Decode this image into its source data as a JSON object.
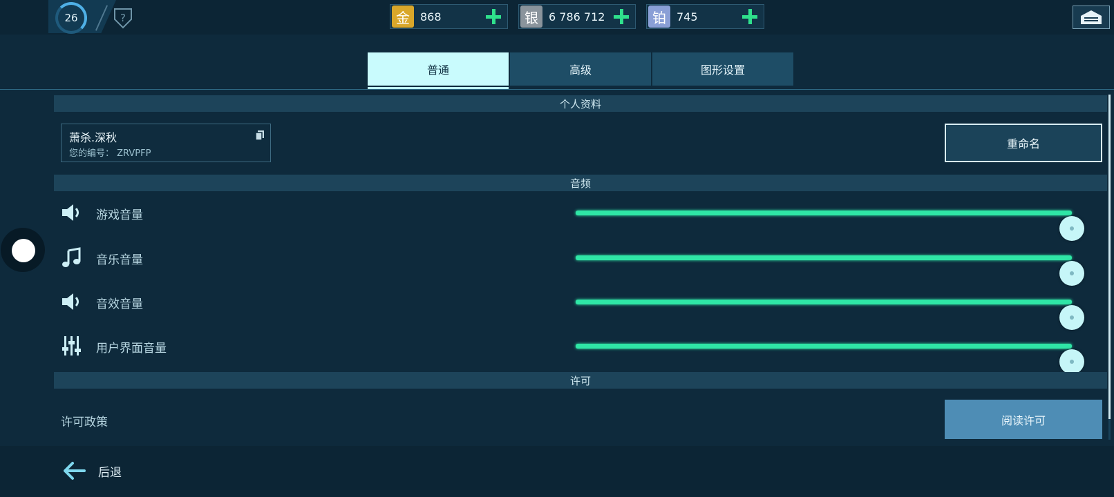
{
  "header": {
    "level": "26",
    "currencies": [
      {
        "name": "gold",
        "symbol": "金",
        "value": "868",
        "color": "#d9a72a"
      },
      {
        "name": "silver",
        "symbol": "银",
        "value": "6 786 712",
        "color": "#8a949c"
      },
      {
        "name": "platinum",
        "symbol": "铂",
        "value": "745",
        "color": "#8a9fd6"
      }
    ]
  },
  "tabs": [
    {
      "label": "普通",
      "active": true
    },
    {
      "label": "高级",
      "active": false
    },
    {
      "label": "图形设置",
      "active": false
    }
  ],
  "profile": {
    "section_title": "个人资料",
    "name": "萧杀.深秋",
    "id_text": "您的编号： ZRVPFP",
    "rename_label": "重命名"
  },
  "audio": {
    "section_title": "音频",
    "rows": [
      {
        "label": "游戏音量",
        "icon": "speaker-icon",
        "level": 1.0
      },
      {
        "label": "音乐音量",
        "icon": "music-note-icon",
        "level": 1.0
      },
      {
        "label": "音效音量",
        "icon": "speaker-icon",
        "level": 1.0
      },
      {
        "label": "用户界面音量",
        "icon": "equalizer-icon",
        "level": 1.0
      }
    ]
  },
  "license": {
    "section_title": "许可",
    "policy_label": "许可政策",
    "read_label": "阅读许可"
  },
  "footer": {
    "back_label": "后退"
  },
  "colors": {
    "accent": "#2fe6a6",
    "tab_active": "#c9fbfd",
    "button_blue": "#4e8db5"
  }
}
